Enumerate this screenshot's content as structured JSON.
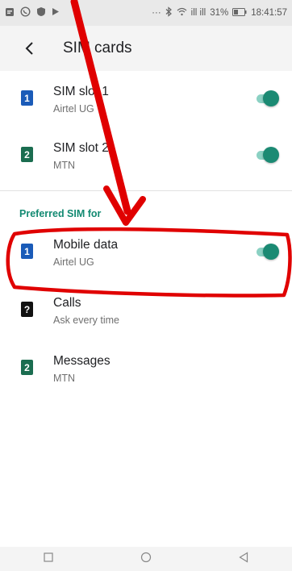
{
  "status_bar": {
    "signal_text": "ill ill",
    "battery_percent": "31%",
    "time": "18:41:57",
    "more": "···"
  },
  "toolbar": {
    "title": "SIM cards"
  },
  "sim_slots": [
    {
      "badge": "1",
      "badge_color": "#1a5bb8",
      "title": "SIM slot 1",
      "subtitle": "Airtel UG",
      "enabled": true
    },
    {
      "badge": "2",
      "badge_color": "#1b6d50",
      "title": "SIM slot 2",
      "subtitle": "MTN",
      "enabled": true
    }
  ],
  "preferred": {
    "header": "Preferred SIM for",
    "items": [
      {
        "badge": "1",
        "badge_color": "#1a5bb8",
        "title": "Mobile data",
        "subtitle": "Airtel UG",
        "toggle": true,
        "toggle_on": true
      },
      {
        "badge": "?",
        "badge_color": "#111111",
        "title": "Calls",
        "subtitle": "Ask every time",
        "toggle": false
      },
      {
        "badge": "2",
        "badge_color": "#1b6d50",
        "title": "Messages",
        "subtitle": "MTN",
        "toggle": false
      }
    ]
  },
  "colors": {
    "accent": "#1b8a73",
    "annotation": "#e00000"
  }
}
